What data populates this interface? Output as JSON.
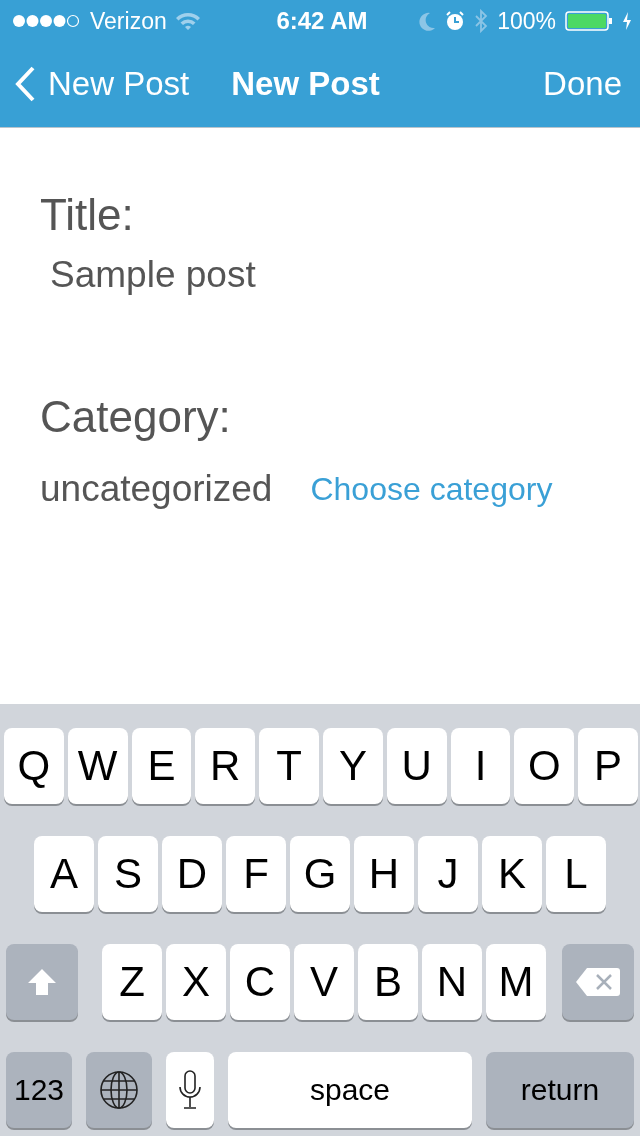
{
  "status_bar": {
    "carrier": "Verizon",
    "time": "6:42 AM",
    "battery": "100%"
  },
  "nav_bar": {
    "back": "New Post",
    "title": "New Post",
    "action": "Done"
  },
  "form": {
    "title_label": "Title:",
    "title_value": "Sample post",
    "category_label": "Category:",
    "category_value": "uncategorized",
    "choose_link": "Choose category"
  },
  "keyboard": {
    "rows": [
      {
        "keys": [
          {
            "kind": "letter",
            "label": "Q"
          },
          {
            "kind": "letter",
            "label": "W"
          },
          {
            "kind": "letter",
            "label": "E"
          },
          {
            "kind": "letter",
            "label": "R"
          },
          {
            "kind": "letter",
            "label": "T"
          },
          {
            "kind": "letter",
            "label": "Y"
          },
          {
            "kind": "letter",
            "label": "U"
          },
          {
            "kind": "letter",
            "label": "I"
          },
          {
            "kind": "letter",
            "label": "O"
          },
          {
            "kind": "letter",
            "label": "P"
          }
        ]
      },
      {
        "keys": [
          {
            "kind": "letter",
            "label": "A"
          },
          {
            "kind": "letter",
            "label": "S"
          },
          {
            "kind": "letter",
            "label": "D"
          },
          {
            "kind": "letter",
            "label": "F"
          },
          {
            "kind": "letter",
            "label": "G"
          },
          {
            "kind": "letter",
            "label": "H"
          },
          {
            "kind": "letter",
            "label": "J"
          },
          {
            "kind": "letter",
            "label": "K"
          },
          {
            "kind": "letter",
            "label": "L"
          }
        ]
      },
      {
        "keys": [
          {
            "kind": "shift"
          },
          {
            "kind": "letter",
            "label": "Z"
          },
          {
            "kind": "letter",
            "label": "X"
          },
          {
            "kind": "letter",
            "label": "C"
          },
          {
            "kind": "letter",
            "label": "V"
          },
          {
            "kind": "letter",
            "label": "B"
          },
          {
            "kind": "letter",
            "label": "N"
          },
          {
            "kind": "letter",
            "label": "M"
          },
          {
            "kind": "delete"
          }
        ]
      },
      {
        "keys": [
          {
            "kind": "numbers",
            "label": "123"
          },
          {
            "kind": "globe"
          },
          {
            "kind": "mic"
          },
          {
            "kind": "space",
            "label": "space"
          },
          {
            "kind": "return",
            "label": "return"
          }
        ]
      }
    ]
  }
}
